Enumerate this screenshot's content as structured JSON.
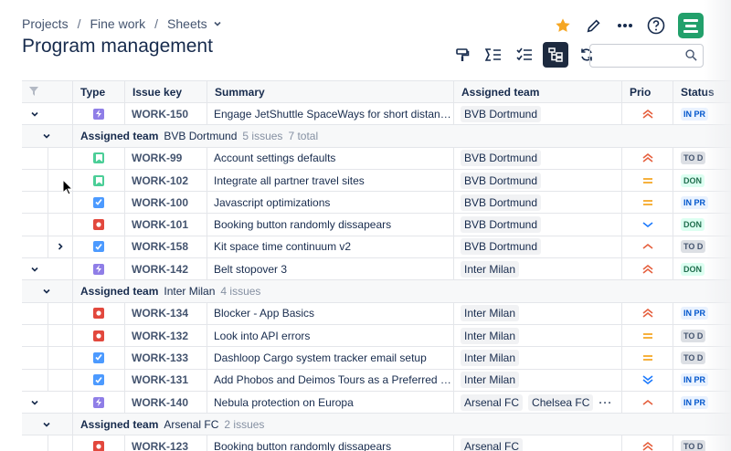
{
  "breadcrumbs": [
    "Projects",
    "Fine work",
    "Sheets"
  ],
  "title": "Program management",
  "top_icons": [
    "star-icon",
    "edit-icon",
    "more-icon",
    "help-icon",
    "app-icon"
  ],
  "toolbar": [
    "paint-format-icon",
    "sum-icon",
    "checklist-icon",
    "hierarchy-icon",
    "refresh-icon"
  ],
  "search": {
    "placeholder": ""
  },
  "columns": [
    "",
    "Type",
    "Issue key",
    "Summary",
    "Assigned team",
    "Prio",
    "Status"
  ],
  "rows": [
    {
      "kind": "issue",
      "chev": "v",
      "indent": 0,
      "type": "epic",
      "key": "WORK-150",
      "summary": "Engage JetShuttle SpaceWays for short distan…",
      "teams": [
        "BVB Dortmund"
      ],
      "prio": "highest",
      "status": "IN PR",
      "st": "inprog"
    },
    {
      "kind": "group",
      "label": "Assigned team",
      "value": "BVB Dortmund",
      "count": "5 issues",
      "extra": "7 total"
    },
    {
      "kind": "issue",
      "chev": "",
      "type": "story",
      "key": "WORK-99",
      "summary": "Account settings defaults",
      "teams": [
        "BVB Dortmund"
      ],
      "prio": "highest",
      "status": "TO D",
      "st": "todo"
    },
    {
      "kind": "issue",
      "chev": "",
      "type": "story",
      "key": "WORK-102",
      "summary": "Integrate all partner travel sites",
      "teams": [
        "BVB Dortmund"
      ],
      "prio": "medium",
      "status": "DON",
      "st": "done"
    },
    {
      "kind": "issue",
      "chev": "",
      "type": "task",
      "key": "WORK-100",
      "summary": "Javascript optimizations",
      "teams": [
        "BVB Dortmund"
      ],
      "prio": "medium",
      "status": "IN PR",
      "st": "inprog"
    },
    {
      "kind": "issue",
      "chev": "",
      "type": "bug",
      "key": "WORK-101",
      "summary": "Booking button randomly dissapears",
      "teams": [
        "BVB Dortmund"
      ],
      "prio": "low",
      "status": "DON",
      "st": "done"
    },
    {
      "kind": "issue",
      "chev": ">",
      "type": "task",
      "key": "WORK-158",
      "summary": "Kit space time continuum v2",
      "teams": [
        "BVB Dortmund"
      ],
      "prio": "high",
      "status": "TO D",
      "st": "todo"
    },
    {
      "kind": "issue",
      "chev": "v",
      "indent": 0,
      "type": "epic",
      "key": "WORK-142",
      "summary": "Belt stopover 3",
      "teams": [
        "Inter Milan"
      ],
      "prio": "highest",
      "status": "DON",
      "st": "done"
    },
    {
      "kind": "group",
      "label": "Assigned team",
      "value": "Inter Milan",
      "count": "4 issues",
      "extra": ""
    },
    {
      "kind": "issue",
      "chev": "",
      "type": "bug",
      "key": "WORK-134",
      "summary": "Blocker - App Basics",
      "teams": [
        "Inter Milan"
      ],
      "prio": "highest",
      "status": "IN PR",
      "st": "inprog"
    },
    {
      "kind": "issue",
      "chev": "",
      "type": "bug",
      "key": "WORK-132",
      "summary": "Look into API errors",
      "teams": [
        "Inter Milan"
      ],
      "prio": "medium",
      "status": "TO D",
      "st": "todo"
    },
    {
      "kind": "issue",
      "chev": "",
      "type": "task",
      "key": "WORK-133",
      "summary": "Dashloop Cargo system tracker email setup",
      "teams": [
        "Inter Milan"
      ],
      "prio": "medium",
      "status": "TO D",
      "st": "todo"
    },
    {
      "kind": "issue",
      "chev": "",
      "type": "task",
      "key": "WORK-131",
      "summary": "Add Phobos and Deimos Tours as a Preferred …",
      "teams": [
        "Inter Milan"
      ],
      "prio": "lowest",
      "status": "IN PR",
      "st": "inprog"
    },
    {
      "kind": "issue",
      "chev": "v",
      "indent": 0,
      "type": "epic",
      "key": "WORK-140",
      "summary": "Nebula protection on Europa",
      "teams": [
        "Arsenal FC",
        "Chelsea FC"
      ],
      "more": "···",
      "prio": "high",
      "status": "IN PR",
      "st": "inprog"
    },
    {
      "kind": "group",
      "label": "Assigned team",
      "value": "Arsenal FC",
      "count": "2 issues",
      "extra": ""
    },
    {
      "kind": "issue",
      "chev": "",
      "type": "bug",
      "key": "WORK-123",
      "summary": "Booking button randomly dissapears",
      "teams": [
        "Arsenal FC"
      ],
      "prio": "highest",
      "status": "TO D",
      "st": "todo"
    }
  ],
  "colors": {
    "accent": "#1d2a3f",
    "star": "#f5a623",
    "app": "#22a06b",
    "prio_high": "#e5603e",
    "prio_medium": "#f5a623",
    "prio_low": "#1d7afc"
  }
}
